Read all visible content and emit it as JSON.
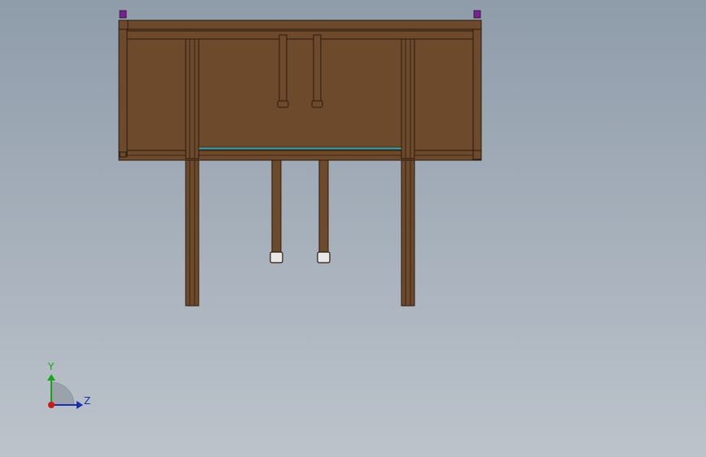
{
  "viewport": {
    "background_top": "#8f9caa",
    "background_bottom": "#bcc3cb"
  },
  "model": {
    "wood_color": "#6e4a2d",
    "edge_color": "#2a1a0c",
    "glass_strip_color": "#3a9aa0",
    "marker_color": "#7a1e9a",
    "foot_cap_color": "#e8e8e8"
  },
  "triad": {
    "y_label": "Y",
    "z_label": "Z",
    "y_color": "#19a519",
    "z_color": "#1a2fb0",
    "x_color": "#d01818"
  }
}
